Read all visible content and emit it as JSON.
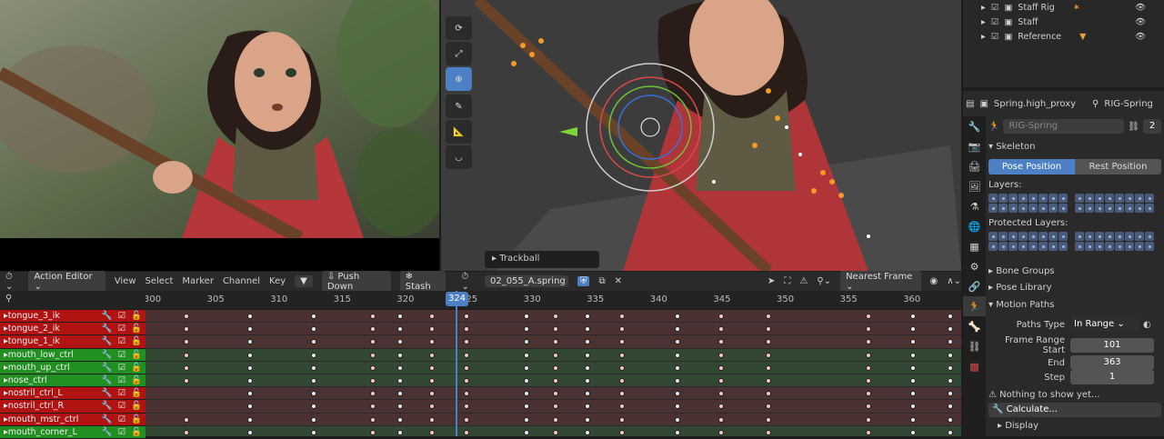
{
  "viewport": {
    "overlay_label": "Trackball"
  },
  "outliner": {
    "rows": [
      {
        "label": "Staff Rig"
      },
      {
        "label": "Staff"
      },
      {
        "label": "Reference"
      }
    ]
  },
  "properties": {
    "header": {
      "object": "Spring.high_proxy",
      "rig": "RIG-Spring",
      "armature_name": "RIG-Spring",
      "users": "2"
    },
    "skeleton": {
      "title": "Skeleton",
      "pose_position": "Pose Position",
      "rest_position": "Rest Position",
      "layers_label": "Layers:",
      "protected_label": "Protected Layers:"
    },
    "sections": {
      "bone_groups": "Bone Groups",
      "pose_library": "Pose Library",
      "motion_paths": "Motion Paths",
      "display": "Display"
    },
    "motion": {
      "paths_type_label": "Paths Type",
      "paths_type_value": "In Range",
      "frame_start_label": "Frame Range Start",
      "frame_start": "101",
      "end_label": "End",
      "end": "363",
      "step_label": "Step",
      "step": "1",
      "nothing": "Nothing to show yet...",
      "calculate": "Calculate..."
    }
  },
  "dopesheet": {
    "mode": "Action Editor",
    "menu": [
      "View",
      "Select",
      "Marker",
      "Channel",
      "Key"
    ],
    "push_down": "Push Down",
    "stash": "Stash",
    "action": "02_055_A.spring",
    "snap": "Nearest Frame",
    "current_frame": "324",
    "ticks": [
      "300",
      "305",
      "310",
      "315",
      "320",
      "325",
      "330",
      "335",
      "340",
      "345",
      "350",
      "355",
      "360"
    ],
    "channels": [
      {
        "name": "tongue_3_ik",
        "color": "red"
      },
      {
        "name": "tongue_2_ik",
        "color": "red"
      },
      {
        "name": "tongue_1_ik",
        "color": "red"
      },
      {
        "name": "mouth_low_ctrl",
        "color": "green"
      },
      {
        "name": "mouth_up_ctrl",
        "color": "green"
      },
      {
        "name": "nose_ctrl",
        "color": "green"
      },
      {
        "name": "nostril_ctrl_L",
        "color": "red"
      },
      {
        "name": "nostril_ctrl_R",
        "color": "red"
      },
      {
        "name": "mouth_mstr_ctrl",
        "color": "red"
      },
      {
        "name": "mouth_corner_L",
        "color": "green"
      }
    ]
  },
  "colors": {
    "accent": "#4d7fc5",
    "channel_red": "#b11212",
    "channel_green": "#218f21"
  }
}
